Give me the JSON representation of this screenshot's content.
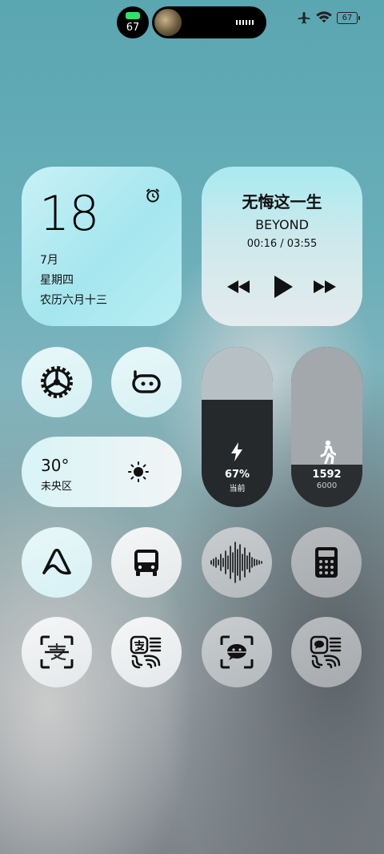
{
  "status_bar": {
    "battery_pill": "67",
    "battery_level": "67"
  },
  "clock_widget": {
    "day": "18",
    "month": "7月",
    "weekday": "星期四",
    "lunar": "农历六月十三"
  },
  "music_widget": {
    "title": "无悔这一生",
    "artist": "BEYOND",
    "time": "00:16 / 03:55"
  },
  "weather_widget": {
    "temp": "30°",
    "location": "未央区"
  },
  "battery_capsule": {
    "value": "67%",
    "label": "当前",
    "level": 0.67
  },
  "steps_capsule": {
    "value": "1592",
    "goal": "6000",
    "level": 0.265
  },
  "icons": {
    "row1": [
      "settings-icon",
      "assistant-icon"
    ],
    "row3": [
      "app-a-icon",
      "bus-icon",
      "voice-wave-icon",
      "calculator-icon"
    ],
    "row4": [
      "alipay-scan-icon",
      "alipay-pay-icon",
      "wechat-scan-icon",
      "wechat-pay-icon"
    ]
  }
}
